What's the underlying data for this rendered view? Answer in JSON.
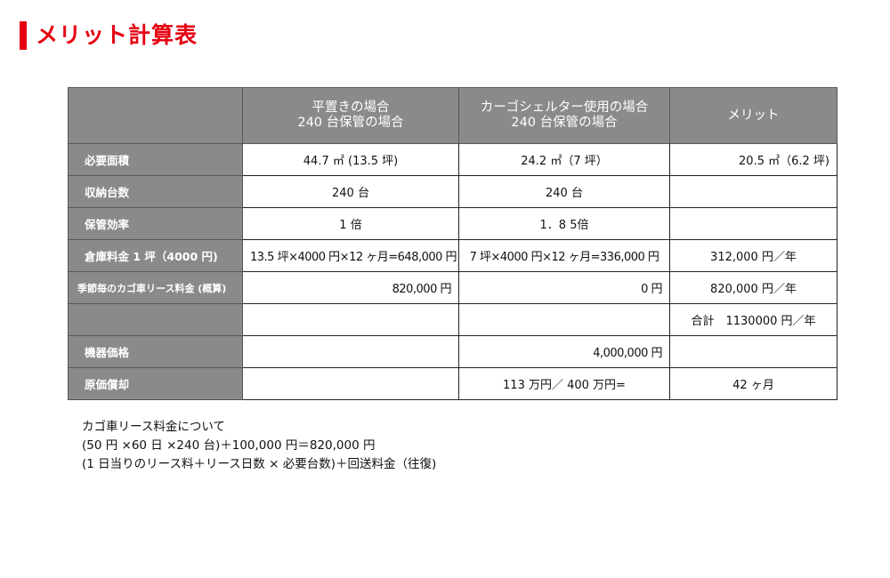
{
  "title": "メリット計算表",
  "table": {
    "headers": [
      "",
      "平置きの場合\n240 台保管の場合",
      "カーゴシェルター使用の場合\n240 台保管の場合",
      "メリット"
    ],
    "rows": [
      {
        "label": "必要面積",
        "c1": "44.7 ㎡ (13.5 坪)",
        "c2": "24.2 ㎡（7 坪）",
        "c3": "20.5 ㎡（6.2 坪)"
      },
      {
        "label": "収納台数",
        "c1": "240 台",
        "c2": "240 台",
        "c3": ""
      },
      {
        "label": "保管効率",
        "c1": "1 倍",
        "c2": "1．8 5倍",
        "c3": ""
      },
      {
        "label": "倉庫料金 1 坪（4000 円)",
        "c1": "13.5 坪×4000 円×12 ヶ月=648,000 円",
        "c2": "7 坪×4000 円×12 ヶ月=336,000 円",
        "c3": "312,000 円／年"
      },
      {
        "label": "季節毎のカゴ車リース料金 (概算)",
        "c1": "820,000 円",
        "c2": "0 円",
        "c3": "820,000 円／年"
      },
      {
        "label": "",
        "c1": "",
        "c2": "",
        "c3": "合計　1130000 円／年"
      },
      {
        "label": "機器価格",
        "c1": "",
        "c2": "4,000,000 円",
        "c3": ""
      },
      {
        "label": "原価償却",
        "c1": "",
        "c2": "113 万円／ 400 万円=",
        "c3": "42 ヶ月"
      }
    ]
  },
  "notes": [
    "カゴ車リース料金について",
    "(50 円 ×60 日 ×240 台)＋100,000 円＝820,000 円",
    "(1 日当りのリース料＋リース日数 × 必要台数)＋回送料金（往復)"
  ]
}
